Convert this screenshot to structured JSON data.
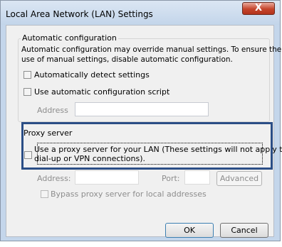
{
  "window": {
    "title": "Local Area Network (LAN) Settings",
    "close_glyph": "X"
  },
  "auto_config": {
    "legend": "Automatic configuration",
    "description_line1": "Automatic configuration may override manual settings.  To ensure the",
    "description_line2": "use of manual settings, disable automatic configuration.",
    "detect_label": "Automatically detect settings",
    "script_label": "Use automatic configuration script",
    "address_label": "Address",
    "address_value": ""
  },
  "proxy": {
    "legend": "Proxy server",
    "use_proxy_line1": "Use a proxy server for your LAN (These settings will not apply to",
    "use_proxy_line2": "dial-up or VPN connections).",
    "address_label": "Address:",
    "address_value": "",
    "port_label": "Port:",
    "port_value": "",
    "advanced_label": "Advanced",
    "bypass_label": "Bypass proxy server for local addresses"
  },
  "buttons": {
    "ok": "OK",
    "cancel": "Cancel"
  },
  "colors": {
    "highlight_border": "#2b4e86",
    "close_button": "#c5442b"
  },
  "icons": [
    "close-icon"
  ]
}
